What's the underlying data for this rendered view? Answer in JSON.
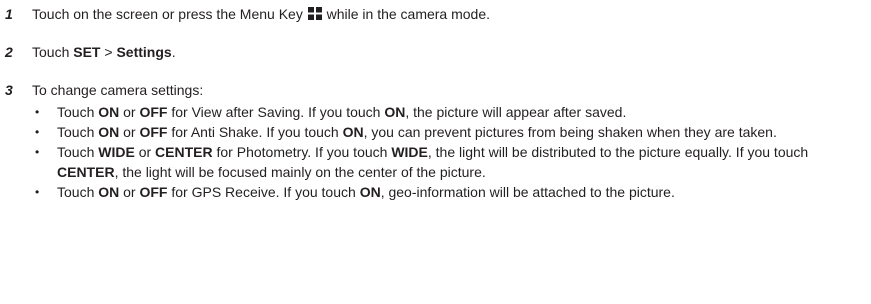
{
  "steps": [
    {
      "num": "1",
      "pre": "Touch on the screen or press the Menu Key ",
      "icon": "menu-key-icon",
      "post": " while in the camera mode."
    },
    {
      "num": "2",
      "pre": "Touch ",
      "bold1": "SET",
      "mid": " > ",
      "bold2": "Settings",
      "post": "."
    },
    {
      "num": "3",
      "text": "To change camera settings:"
    }
  ],
  "bullets": [
    {
      "glyph": "•",
      "p1": "Touch ",
      "b1": "ON",
      "p2": " or ",
      "b2": "OFF",
      "p3": " for View after Saving. If you touch ",
      "b3": "ON",
      "p4": ", the picture will appear after saved."
    },
    {
      "glyph": "•",
      "p1": "Touch ",
      "b1": "ON",
      "p2": " or ",
      "b2": "OFF",
      "p3": " for Anti Shake. If you touch ",
      "b3": "ON",
      "p4": ", you can prevent pictures from being shaken when they are taken."
    },
    {
      "glyph": "•",
      "p1": "Touch ",
      "b1": "WIDE",
      "p2": " or ",
      "b2": "CENTER",
      "p3": " for Photometry. If you touch ",
      "b3": "WIDE",
      "p4": ", the light will be distributed to the picture equally. If you touch ",
      "b4": "CENTER",
      "p5": ", the light will be focused mainly on the center of the picture."
    },
    {
      "glyph": "•",
      "p1": "Touch ",
      "b1": "ON",
      "p2": " or ",
      "b2": "OFF",
      "p3": " for GPS Receive. If you touch ",
      "b3": "ON",
      "p4": ", geo-information will be attached to the picture."
    }
  ],
  "colors": {
    "text": "#231f20",
    "background": "#ffffff"
  }
}
